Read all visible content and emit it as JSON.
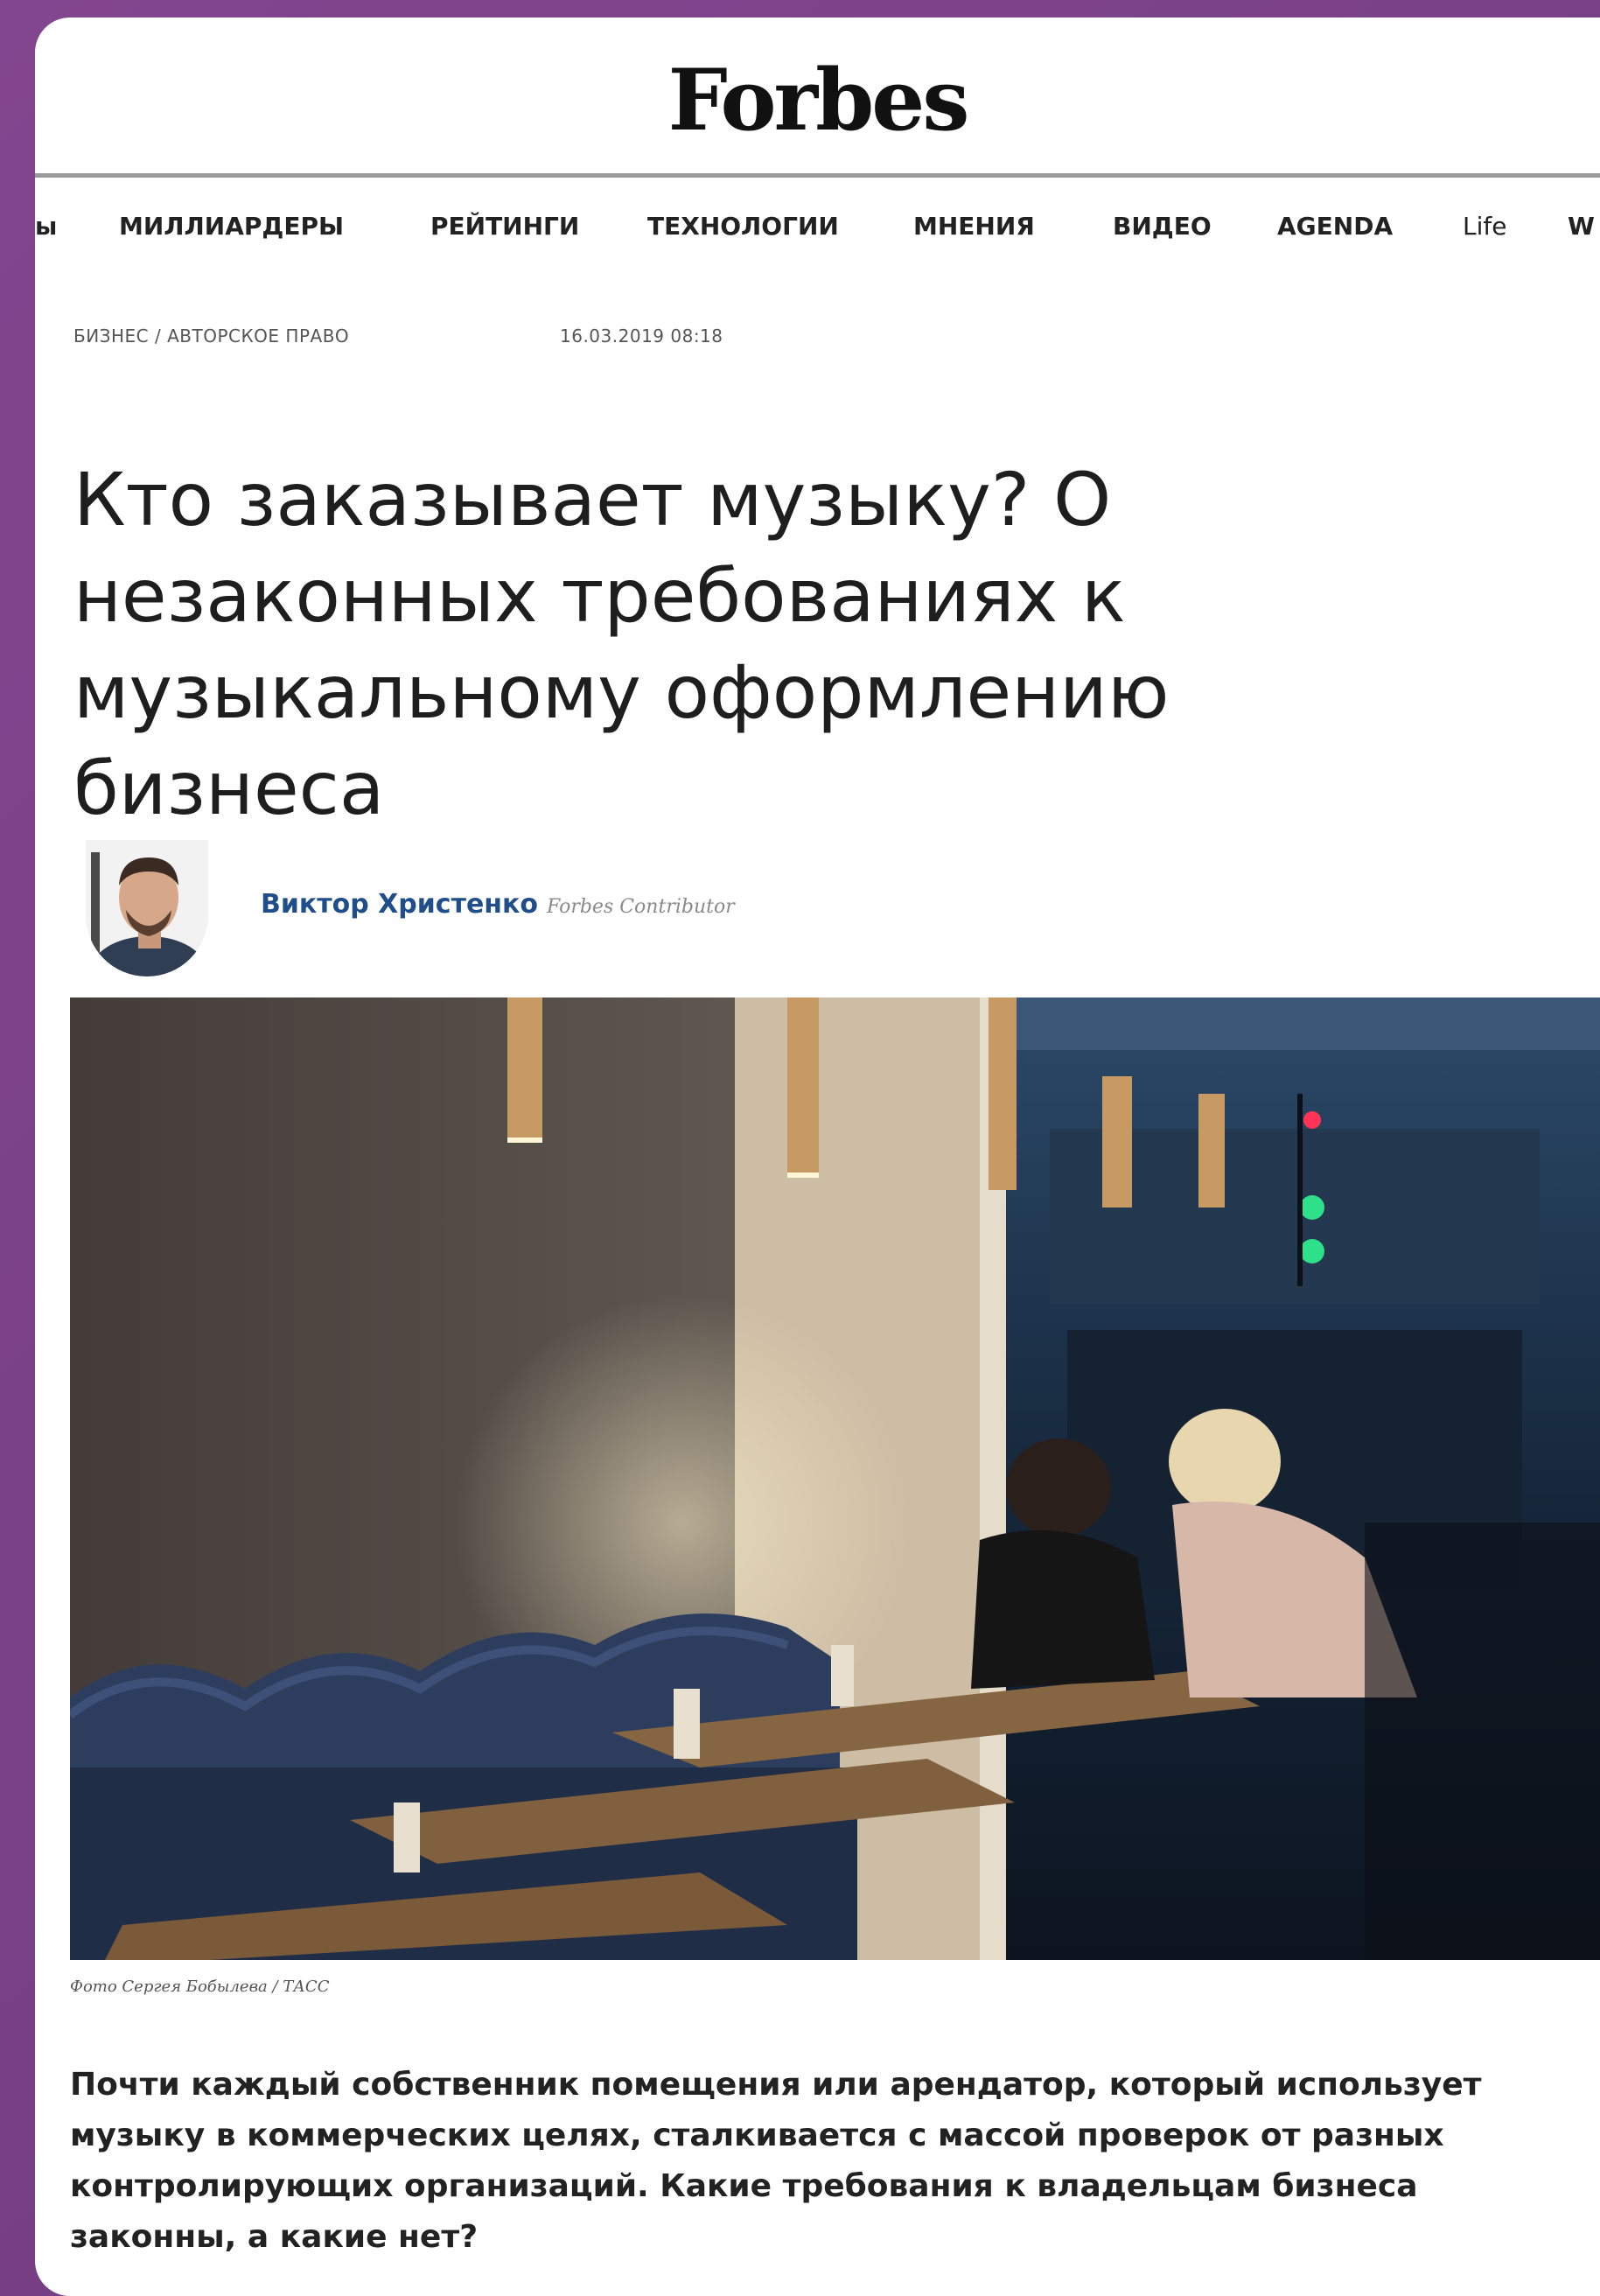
{
  "site": {
    "logo": "Forbes"
  },
  "nav": {
    "items": [
      "ы",
      "МИЛЛИАРДЕРЫ",
      "РЕЙТИНГИ",
      "ТЕХНОЛОГИИ",
      "МНЕНИЯ",
      "ВИДЕО",
      "AGENDA",
      "Life",
      "W"
    ]
  },
  "article": {
    "breadcrumb": "БИЗНЕС / АВТОРСКОЕ ПРАВО",
    "date": "16.03.2019 08:18",
    "title": "Кто заказывает музыку? О незаконных требованиях к музыкальному оформлению бизнеса",
    "author_name": "Виктор Христенко",
    "author_role": "Forbes Contributor",
    "photo_caption": "Фото Сергея Бобылева / ТАСС",
    "lead": "Почти каждый собственник помещения или арендатор, который использует музыку в коммерческих целях, сталкивается с массой проверок от разных контролирующих организаций. Какие требования к владельцам бизнеса законны, а какие нет?"
  },
  "colors": {
    "frame": "#7a3f86",
    "author_link": "#1f4e8a",
    "text": "#1e1e1e"
  }
}
